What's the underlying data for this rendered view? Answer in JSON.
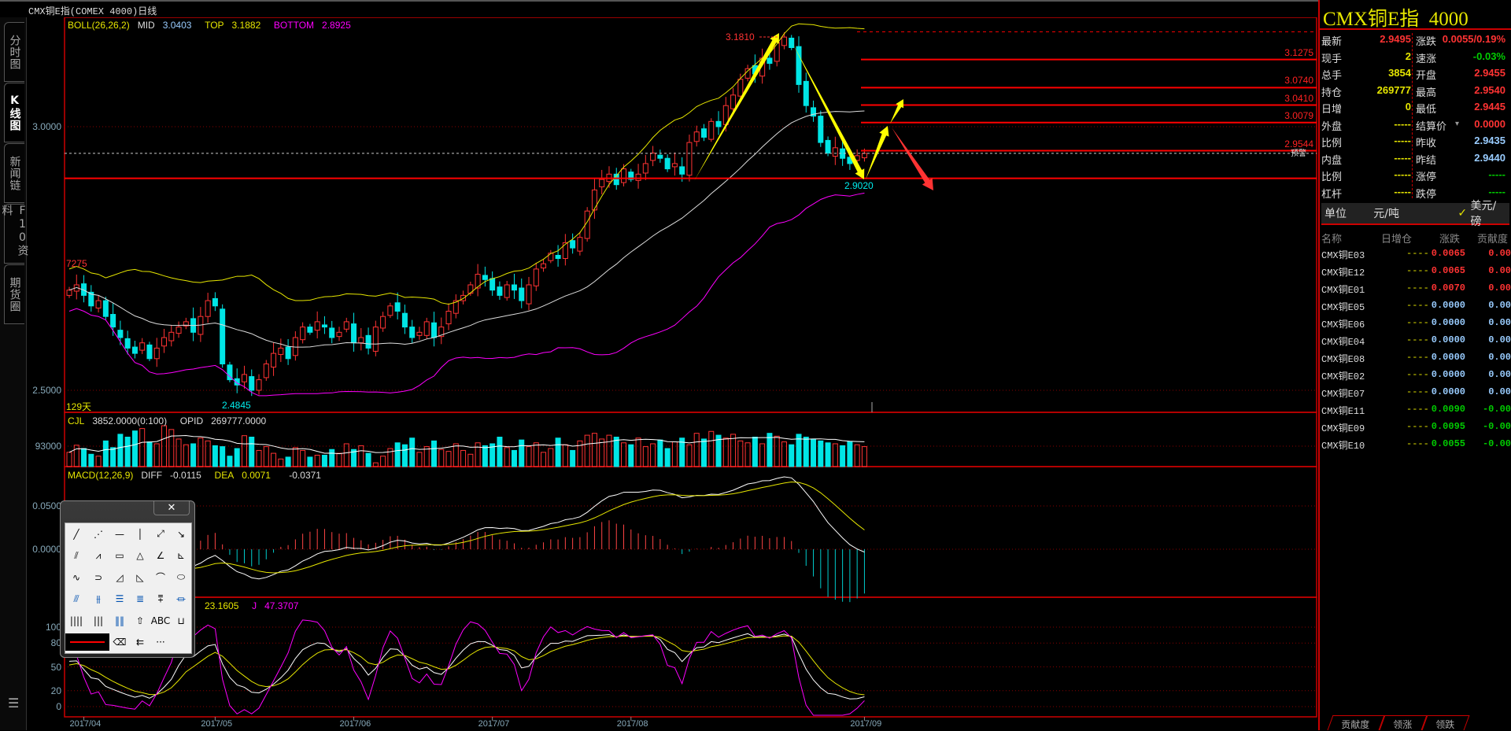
{
  "window": {
    "title": "CMX铜E指(COMEX 4000)日线",
    "link_icon": "link-icon"
  },
  "left_tabs": [
    {
      "label": "分时图"
    },
    {
      "label": "K线图",
      "active": true
    },
    {
      "label": "新闻链"
    },
    {
      "label": "F10资料"
    },
    {
      "label": "期货圈"
    }
  ],
  "menu_icon": "hamburger-menu-icon",
  "indicators": {
    "boll": {
      "name": "BOLL(26,26,2)",
      "mid_label": "MID",
      "mid": "3.0403",
      "top_label": "TOP",
      "top": "3.1882",
      "bottom_label": "BOTTOM",
      "bottom": "2.8925"
    },
    "vol": {
      "name": "CJL",
      "value": "3852.0000(0:100)",
      "opid_label": "OPID",
      "opid": "269777.0000"
    },
    "macd": {
      "name": "MACD(12,26,9)",
      "diff_label": "DIFF",
      "diff": "-0.0115",
      "dea_label": "DEA",
      "dea": "0.0071",
      "macd": "-0.0371"
    },
    "kdj": {
      "d": "23.1605",
      "j_label": "J",
      "j": "47.3707"
    }
  },
  "axes": {
    "price_ticks": [
      {
        "label": "3.0000",
        "value": 3.0
      },
      {
        "label": "2.5000",
        "value": 2.5
      }
    ],
    "vol_ticks": [
      {
        "label": "93000",
        "value": 93000
      }
    ],
    "macd_ticks": [
      {
        "label": "0.0500",
        "value": 0.05
      },
      {
        "label": "0.0000",
        "value": 0
      }
    ],
    "kdj_ticks": [
      {
        "label": "100",
        "value": 100
      },
      {
        "label": "80",
        "value": 80
      },
      {
        "label": "50",
        "value": 50
      },
      {
        "label": "20",
        "value": 20
      },
      {
        "label": "0",
        "value": 0
      }
    ],
    "dates": [
      {
        "label": "2017/04",
        "index": 2
      },
      {
        "label": "2017/05",
        "index": 20
      },
      {
        "label": "2017/06",
        "index": 39
      },
      {
        "label": "2017/07",
        "index": 58
      },
      {
        "label": "2017/08",
        "index": 77
      },
      {
        "label": "2017/09",
        "index": 109
      }
    ]
  },
  "annotations": {
    "days": "129天",
    "partial_label": "7275",
    "high": "3.1810",
    "low_aug": "2.9020",
    "low_may": "2.4845",
    "warn": "预警"
  },
  "levels": [
    {
      "label": "3.1275",
      "value": 3.1275
    },
    {
      "label": "3.0740",
      "value": 3.074
    },
    {
      "label": "3.0410",
      "value": 3.041
    },
    {
      "label": "3.0079",
      "value": 3.0079
    },
    {
      "label": "2.9544",
      "value": 2.9544
    }
  ],
  "support_level": 2.902,
  "top_dashed_level": 3.18,
  "last_price": 2.9495,
  "colors": {
    "up": "#ff3333",
    "down": "#00e5e5",
    "boll_top": "#e6e600",
    "boll_mid": "#dddddd",
    "boll_bottom": "#ff00ff",
    "level": "#ff0000",
    "arrow_up": "#ffff00",
    "arrow_down": "#ff3333"
  },
  "chart_data": {
    "type": "candlestick",
    "closes": [
      2.69,
      2.7,
      2.68,
      2.66,
      2.67,
      2.64,
      2.62,
      2.6,
      2.58,
      2.57,
      2.59,
      2.56,
      2.58,
      2.6,
      2.61,
      2.62,
      2.63,
      2.61,
      2.64,
      2.67,
      2.66,
      2.55,
      2.52,
      2.51,
      2.53,
      2.5,
      2.52,
      2.55,
      2.57,
      2.58,
      2.56,
      2.6,
      2.62,
      2.61,
      2.63,
      2.62,
      2.6,
      2.61,
      2.63,
      2.59,
      2.6,
      2.58,
      2.62,
      2.64,
      2.66,
      2.65,
      2.62,
      2.6,
      2.61,
      2.63,
      2.6,
      2.62,
      2.65,
      2.67,
      2.68,
      2.7,
      2.72,
      2.71,
      2.69,
      2.68,
      2.7,
      2.69,
      2.67,
      2.7,
      2.73,
      2.74,
      2.76,
      2.75,
      2.78,
      2.77,
      2.79,
      2.84,
      2.88,
      2.9,
      2.91,
      2.89,
      2.92,
      2.9,
      2.91,
      2.93,
      2.95,
      2.94,
      2.92,
      2.93,
      2.91,
      2.97,
      2.99,
      2.98,
      3.01,
      3.0,
      3.04,
      3.06,
      3.09,
      3.11,
      3.1,
      3.13,
      3.12,
      3.16,
      3.17,
      3.15,
      3.08,
      3.04,
      3.02,
      2.97,
      2.95,
      2.96,
      2.94,
      2.93,
      2.945,
      2.9495
    ],
    "volumes": [
      80000,
      95000,
      88000,
      76000,
      72000,
      104000,
      90000,
      118000,
      112000,
      125000,
      130000,
      102000,
      98000,
      136000,
      128000,
      108000,
      96000,
      98000,
      110000,
      104000,
      94000,
      92000,
      72000,
      88000,
      115000,
      112000,
      84000,
      92000,
      78000,
      66000,
      70000,
      90000,
      84000,
      70000,
      74000,
      74000,
      86000,
      78000,
      98000,
      86000,
      94000,
      78000,
      58000,
      72000,
      88000,
      100000,
      96000,
      110000,
      80000,
      92000,
      104000,
      86000,
      82000,
      98000,
      84000,
      76000,
      100000,
      94000,
      98000,
      112000,
      90000,
      84000,
      106000,
      92000,
      100000,
      80000,
      88000,
      110000,
      96000,
      84000,
      104000,
      116000,
      120000,
      108000,
      116000,
      112000,
      100000,
      96000,
      110000,
      92000,
      98000,
      106000,
      88000,
      102000,
      110000,
      96000,
      120000,
      108000,
      124000,
      116000,
      110000,
      118000,
      104000,
      100000,
      112000,
      98000,
      120000,
      114000,
      102000,
      96000,
      118000,
      112000,
      108000,
      104000,
      100000,
      98000,
      94000,
      102000,
      96000,
      92000
    ],
    "ylim": [
      2.45,
      3.2
    ]
  },
  "quote": {
    "title": "CMX铜E指",
    "code": "4000",
    "left": [
      {
        "k": "最新",
        "v": "2.9495",
        "c": "r"
      },
      {
        "k": "现手",
        "v": "2",
        "c": "y"
      },
      {
        "k": "总手",
        "v": "3854",
        "c": "y"
      },
      {
        "k": "持仓",
        "v": "269777",
        "c": "y"
      },
      {
        "k": "日增",
        "v": "0",
        "c": "y"
      },
      {
        "k": "外盘",
        "v": "-----",
        "c": "y"
      },
      {
        "k": "比例",
        "v": "-----",
        "c": "y"
      },
      {
        "k": "内盘",
        "v": "-----",
        "c": "y"
      },
      {
        "k": "比例",
        "v": "-----",
        "c": "y"
      },
      {
        "k": "杠杆",
        "v": "-----",
        "c": "y"
      }
    ],
    "right": [
      {
        "k": "涨跌",
        "v": "0.0055/0.19%",
        "c": "r"
      },
      {
        "k": "速涨",
        "v": "-0.03%",
        "c": "g"
      },
      {
        "k": "开盘",
        "v": "2.9455",
        "c": "r"
      },
      {
        "k": "最高",
        "v": "2.9540",
        "c": "r"
      },
      {
        "k": "最低",
        "v": "2.9445",
        "c": "r"
      },
      {
        "k": "结算价",
        "v": "0.0000",
        "c": "r",
        "dropdown": true
      },
      {
        "k": "昨收",
        "v": "2.9435",
        "c": "lb"
      },
      {
        "k": "昨结",
        "v": "2.9440",
        "c": "lb"
      },
      {
        "k": "涨停",
        "v": "-----",
        "c": "g"
      },
      {
        "k": "跌停",
        "v": "-----",
        "c": "g"
      }
    ],
    "unit_label": "单位",
    "unit_cny": "元/吨",
    "unit_usd": "美元/磅"
  },
  "list": {
    "headers": [
      "名称",
      "日增仓",
      "涨跌",
      "贡献度"
    ],
    "rows": [
      {
        "name": "CMX铜E03",
        "oi": "----",
        "chg": "0.0065",
        "contrib": "0.00",
        "c": "r"
      },
      {
        "name": "CMX铜E12",
        "oi": "----",
        "chg": "0.0065",
        "contrib": "0.00",
        "c": "r"
      },
      {
        "name": "CMX铜E01",
        "oi": "----",
        "chg": "0.0070",
        "contrib": "0.00",
        "c": "r"
      },
      {
        "name": "CMX铜E05",
        "oi": "----",
        "chg": "0.0000",
        "contrib": "0.00",
        "c": "lb"
      },
      {
        "name": "CMX铜E06",
        "oi": "----",
        "chg": "0.0000",
        "contrib": "0.00",
        "c": "lb"
      },
      {
        "name": "CMX铜E04",
        "oi": "----",
        "chg": "0.0000",
        "contrib": "0.00",
        "c": "lb"
      },
      {
        "name": "CMX铜E08",
        "oi": "----",
        "chg": "0.0000",
        "contrib": "0.00",
        "c": "lb"
      },
      {
        "name": "CMX铜E02",
        "oi": "----",
        "chg": "0.0000",
        "contrib": "0.00",
        "c": "lb"
      },
      {
        "name": "CMX铜E07",
        "oi": "----",
        "chg": "0.0000",
        "contrib": "0.00",
        "c": "lb"
      },
      {
        "name": "CMX铜E11",
        "oi": "----",
        "chg": "0.0090",
        "contrib": "-0.00",
        "c": "g"
      },
      {
        "name": "CMX铜E09",
        "oi": "----",
        "chg": "0.0095",
        "contrib": "-0.00",
        "c": "g"
      },
      {
        "name": "CMX铜E10",
        "oi": "----",
        "chg": "0.0055",
        "contrib": "-0.00",
        "c": "g"
      }
    ]
  },
  "bottom_tabs": [
    "贡献度",
    "领涨",
    "领跌"
  ],
  "toolbox": {
    "close": "✕",
    "tools": [
      {
        "n": "line-tool",
        "g": "╱"
      },
      {
        "n": "ray-tool",
        "g": "⋰"
      },
      {
        "n": "horizontal-line-tool",
        "g": "—"
      },
      {
        "n": "vertical-line-tool",
        "g": "│"
      },
      {
        "n": "segment-tool",
        "g": "⤢"
      },
      {
        "n": "arrow-tool",
        "g": "↘"
      },
      {
        "n": "parallel-lines-tool",
        "g": "⫽"
      },
      {
        "n": "polyline-tool",
        "g": "⩘"
      },
      {
        "n": "rectangle-tool",
        "g": "▭"
      },
      {
        "n": "triangle-tool",
        "g": "△"
      },
      {
        "n": "angle-tool",
        "g": "∠"
      },
      {
        "n": "fan-tool",
        "g": "⊾"
      },
      {
        "n": "sine-tool",
        "g": "∿"
      },
      {
        "n": "cycle-tool",
        "g": "⊃"
      },
      {
        "n": "gann-angle-tool",
        "g": "◿"
      },
      {
        "n": "gann-fan-tool",
        "g": "◺"
      },
      {
        "n": "arc-tool",
        "g": "⌒"
      },
      {
        "n": "ellipse-tool",
        "g": "⬭"
      },
      {
        "n": "speed-resistance-tool",
        "g": "⫻"
      },
      {
        "n": "fibonacci-fan-tool",
        "g": "⫵"
      },
      {
        "n": "gann-grid-tool",
        "g": "☰"
      },
      {
        "n": "percent-lines-tool",
        "g": "≣"
      },
      {
        "n": "andrews-tool",
        "g": "⩱"
      },
      {
        "n": "channel-tool",
        "g": "⏛"
      },
      {
        "n": "fibonacci-time-tool",
        "g": "||||"
      },
      {
        "n": "time-cycle-tool",
        "g": "|||"
      },
      {
        "n": "time-zone-tool",
        "g": "‖‖"
      },
      {
        "n": "up-arrow-tool",
        "g": "⇧"
      },
      {
        "n": "text-tool",
        "g": "ABC"
      },
      {
        "n": "ruler-tool",
        "g": "⊔"
      },
      {
        "n": "line-style-tool",
        "g": ""
      },
      {
        "n": "",
        "g": ""
      },
      {
        "n": "eraser-tool",
        "g": "⌫"
      },
      {
        "n": "color-tool",
        "g": "⇇"
      },
      {
        "n": "more-tools",
        "g": "···"
      }
    ]
  }
}
